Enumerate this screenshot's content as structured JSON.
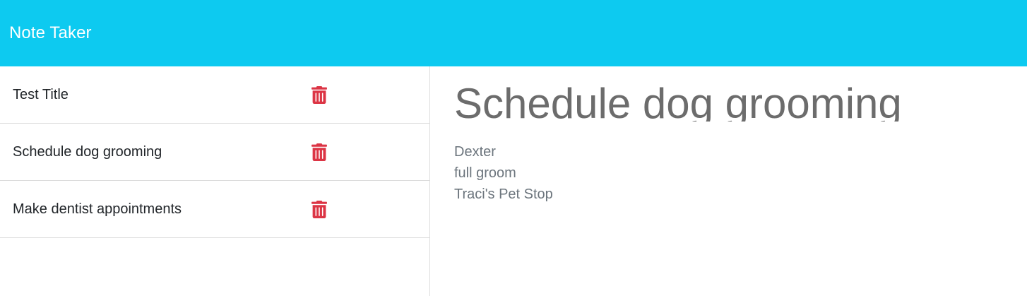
{
  "navbar": {
    "brand": "Note Taker",
    "color": "#0dcaf0"
  },
  "sidebar": {
    "notes": [
      {
        "title": "Test Title",
        "delete_icon": "trash-icon"
      },
      {
        "title": "Schedule dog grooming",
        "delete_icon": "trash-icon"
      },
      {
        "title": "Make dentist appointments",
        "delete_icon": "trash-icon"
      }
    ],
    "trash_color": "#dc3545"
  },
  "active_note": {
    "title": "Schedule dog grooming",
    "body_lines": [
      "Dexter",
      "full groom",
      "Traci's Pet Stop"
    ]
  }
}
